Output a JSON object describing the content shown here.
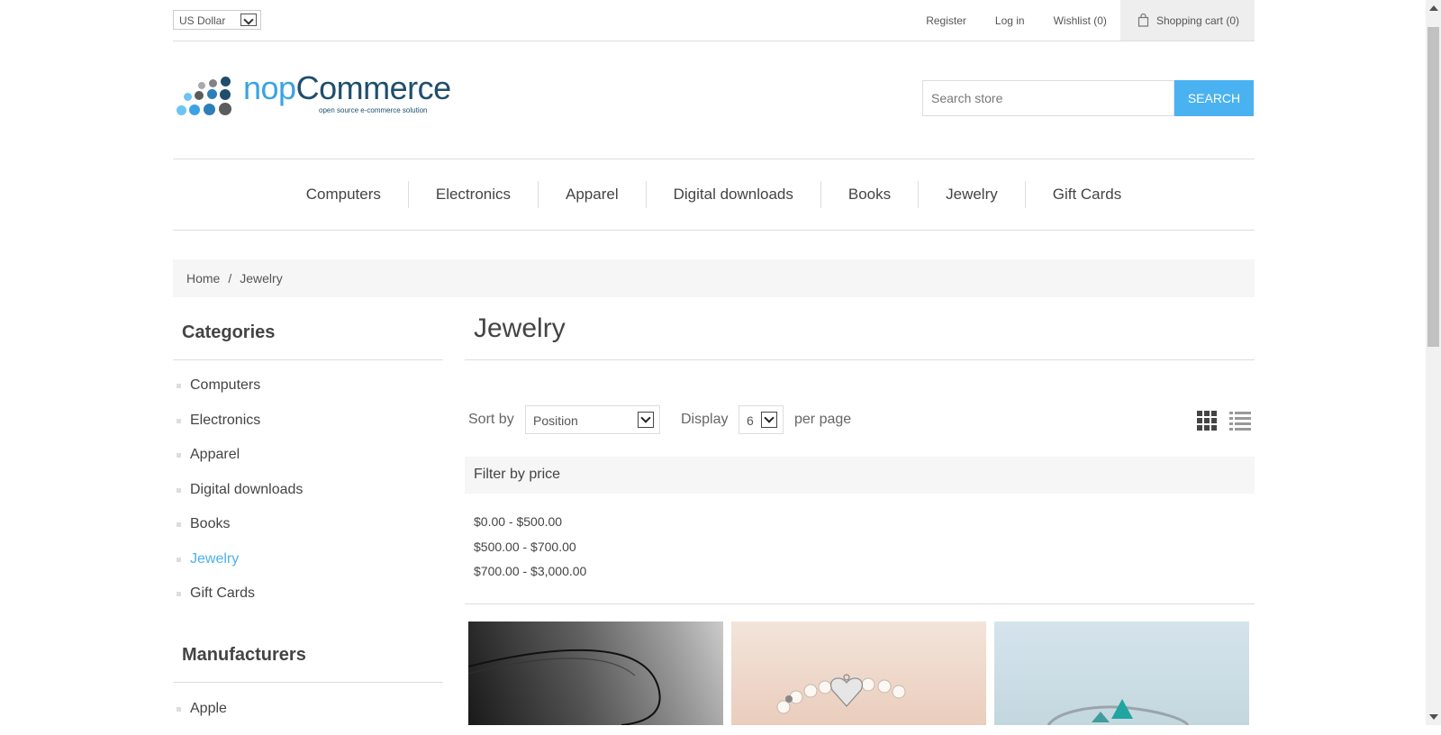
{
  "header": {
    "currency": "US Dollar",
    "links": {
      "register": "Register",
      "login": "Log in",
      "wishlist": "Wishlist (0)",
      "cart": "Shopping cart (0)"
    }
  },
  "logo": {
    "word1": "nop",
    "word2": "Commerce",
    "tagline": "open source e-commerce solution"
  },
  "search": {
    "placeholder": "Search store",
    "button": "SEARCH"
  },
  "menu": [
    "Computers",
    "Electronics",
    "Apparel",
    "Digital downloads",
    "Books",
    "Jewelry",
    "Gift Cards"
  ],
  "breadcrumb": {
    "home": "Home",
    "separator": "/",
    "current": "Jewelry"
  },
  "sidebar": {
    "categories_title": "Categories",
    "categories": [
      "Computers",
      "Electronics",
      "Apparel",
      "Digital downloads",
      "Books",
      "Jewelry",
      "Gift Cards"
    ],
    "active_category": "Jewelry",
    "manufacturers_title": "Manufacturers",
    "manufacturers": [
      "Apple"
    ]
  },
  "main": {
    "title": "Jewelry",
    "sort_label": "Sort by",
    "sort_value": "Position",
    "display_label": "Display",
    "display_value": "6",
    "per_page_label": "per page",
    "filter_title": "Filter by price",
    "price_ranges": [
      "$0.00 - $500.00",
      "$500.00 - $700.00",
      "$700.00 - $3,000.00"
    ],
    "products": [
      "necklace",
      "flower-girl-bracelet",
      "turquoise-bangle"
    ]
  },
  "colors": {
    "accent": "#4ab2f1",
    "logo_dark": "#1f4e6b",
    "panel": "#f6f6f6"
  }
}
